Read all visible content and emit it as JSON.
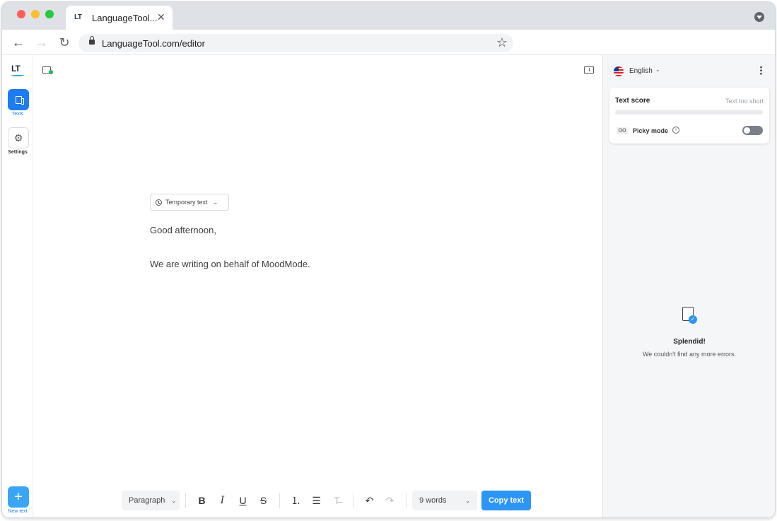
{
  "browser": {
    "tab_title": "LanguageTool...",
    "tab_icon_text": "LT",
    "url": "LanguageTool.com/editor"
  },
  "rail": {
    "logo_text": "LT",
    "items": [
      {
        "label": "Texts",
        "icon": "document-icon",
        "active": true
      },
      {
        "label": "Settings",
        "icon": "gear-icon",
        "active": false
      }
    ],
    "new_text_label": "New text"
  },
  "editor": {
    "text_mode_label": "Temporary text",
    "paragraphs": [
      "Good afternoon,",
      "We are writing on behalf of MoodMode."
    ],
    "toolbar": {
      "block_style": "Paragraph",
      "word_count": "9 words",
      "copy_label": "Copy text"
    }
  },
  "sidebar": {
    "language": "English",
    "text_score": {
      "title": "Text score",
      "status": "Text too short",
      "score_fraction": 0
    },
    "picky_mode": {
      "label": "Picky mode",
      "enabled": false
    },
    "empty_state": {
      "title": "Splendid!",
      "subtitle": "We couldn't find any more errors."
    }
  },
  "colors": {
    "accent": "#2d95f5",
    "rail_active": "#1d7cf2",
    "status_dot": "#1db954"
  }
}
